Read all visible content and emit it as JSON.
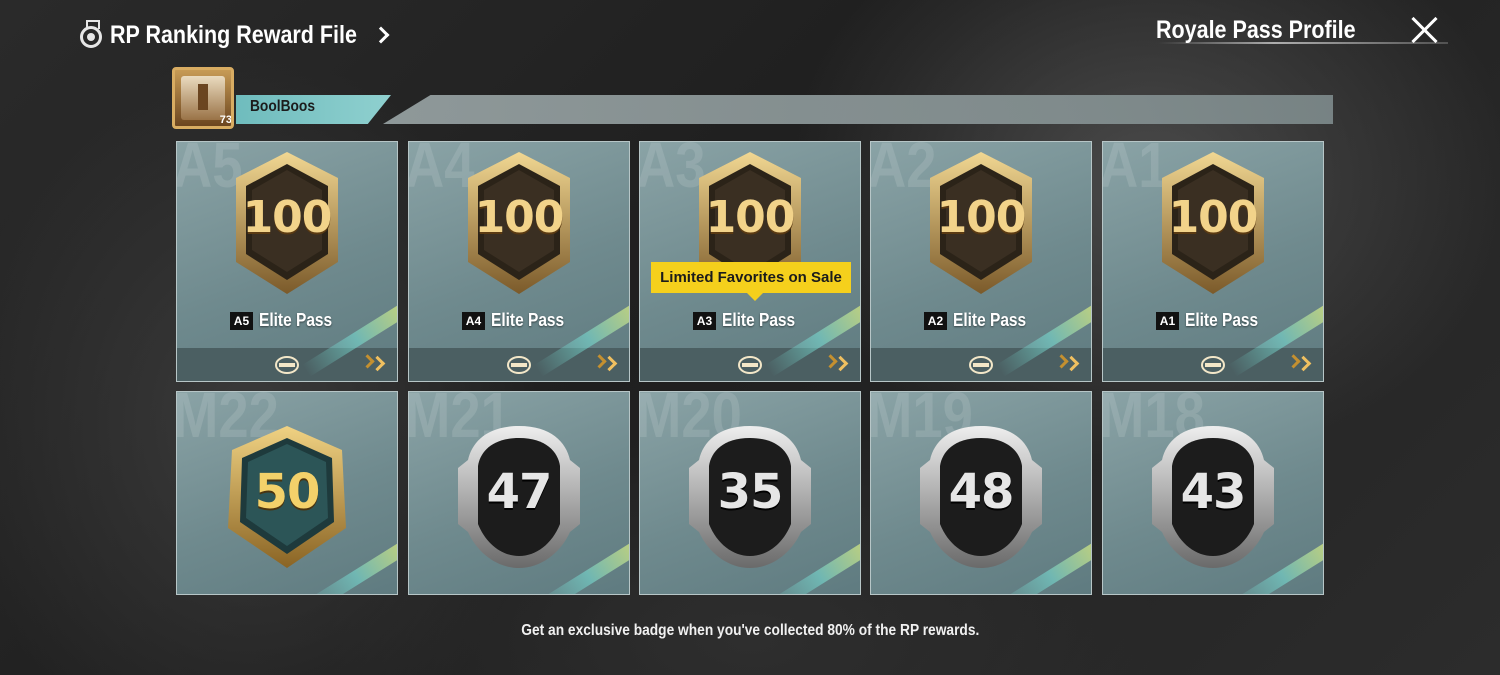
{
  "topbar": {
    "title": "RP Ranking Reward File",
    "profile_title": "Royale Pass Profile"
  },
  "player": {
    "name": "BoolBoos",
    "avatar_level": "73"
  },
  "cards": [
    {
      "season": "A5",
      "badge_value": "100",
      "pass_tag": "A5",
      "pass_label": "Elite Pass",
      "style": "gold"
    },
    {
      "season": "A4",
      "badge_value": "100",
      "pass_tag": "A4",
      "pass_label": "Elite Pass",
      "style": "gold"
    },
    {
      "season": "A3",
      "badge_value": "100",
      "pass_tag": "A3",
      "pass_label": "Elite Pass",
      "style": "gold",
      "banner": "Limited Favorites on Sale"
    },
    {
      "season": "A2",
      "badge_value": "100",
      "pass_tag": "A2",
      "pass_label": "Elite Pass",
      "style": "gold"
    },
    {
      "season": "A1",
      "badge_value": "100",
      "pass_tag": "A1",
      "pass_label": "Elite Pass",
      "style": "gold"
    },
    {
      "season": "M22",
      "badge_value": "50",
      "style": "gold"
    },
    {
      "season": "M21",
      "badge_value": "47",
      "style": "silver"
    },
    {
      "season": "M20",
      "badge_value": "35",
      "style": "silver"
    },
    {
      "season": "M19",
      "badge_value": "48",
      "style": "silver"
    },
    {
      "season": "M18",
      "badge_value": "43",
      "style": "silver"
    }
  ],
  "bottom_note": "Get an exclusive badge when you've collected 80% of the RP rewards.",
  "colors": {
    "sale_banner": "#f5d01c",
    "card_bg": "#7a9497",
    "gold": "#d9b36a",
    "silver": "#c8c8c8"
  }
}
